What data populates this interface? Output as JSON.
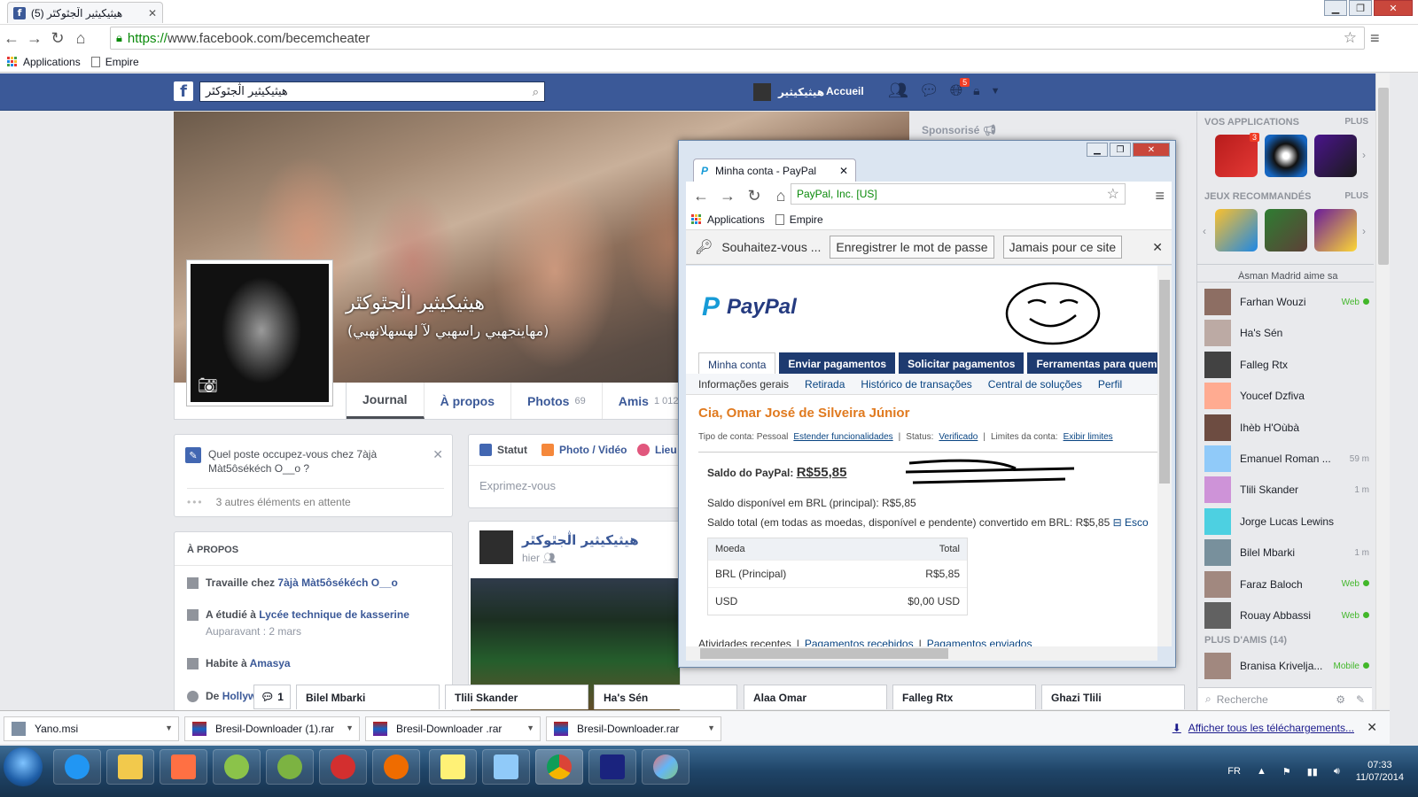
{
  "browser": {
    "tab_title": "(5) هيثيكيثير اڷجٿوكٿر",
    "url_scheme": "https://",
    "url_rest": "www.facebook.com/becemcheater",
    "bookmarks": [
      "Applications",
      "Empire"
    ]
  },
  "facebook": {
    "search_value": "هيثيكيثير اڷجٿوكٿر",
    "user_name": "هيثيكيثير",
    "home_label": "Accueil",
    "notif_count": "5",
    "profile_name": "هيثيكيثير اڷجٿوكٿر",
    "profile_subtitle": "(مهاينجهبي راسهبي لآ لهسهلانهبي)",
    "tabs": [
      {
        "label": "Journal",
        "count": ""
      },
      {
        "label": "À propos",
        "count": ""
      },
      {
        "label": "Photos",
        "count": "69"
      },
      {
        "label": "Amis",
        "count": "1 012"
      }
    ],
    "job_prompt": "Quel poste occupez-vous chez 7àjà Màt5ôsékéch O__o ?",
    "pending": "3 autres éléments en attente",
    "about_header": "À PROPOS",
    "about": {
      "work_prefix": "Travaille chez",
      "work_link": "7àjà Màt5ôsékéch O__o",
      "study_prefix": "A étudié à",
      "study_link": "Lycée technique de kasserine",
      "study_sub": "Auparavant : 2 mars",
      "lives_prefix": "Habite à",
      "lives_link": "Amasya",
      "from_prefix": "De",
      "from_link": "Hollyw"
    },
    "composer": {
      "status": "Statut",
      "photo": "Photo / Vidéo",
      "place": "Lieu",
      "placeholder": "Exprimez-vous"
    },
    "post": {
      "name": "هيثيكيثير اڷجٿوكٿر",
      "time": "hier"
    },
    "sponsored": "Sponsorisé",
    "sidebar": {
      "apps_header": "VOS APPLICATIONS",
      "more": "PLUS",
      "games_header": "JEUX RECOMMANDÉS",
      "app_badge": "3",
      "ticker": "Ásman Madrid aime sa",
      "contacts": [
        {
          "name": "Farhan Wouzi",
          "status": "Web",
          "online": true
        },
        {
          "name": "Ha's Sén",
          "status": "",
          "online": false
        },
        {
          "name": "Falleg Rtx",
          "status": "",
          "online": false
        },
        {
          "name": "Youcef Dzfiva",
          "status": "",
          "online": false
        },
        {
          "name": "Ihèb H'Oùbà",
          "status": "",
          "online": false
        },
        {
          "name": "Emanuel Roman ...",
          "status": "59 m",
          "online": false
        },
        {
          "name": "Tlili Skander",
          "status": "1 m",
          "online": false
        },
        {
          "name": "Jorge Lucas Lewins",
          "status": "",
          "online": false
        },
        {
          "name": "Bilel Mbarki",
          "status": "1 m",
          "online": false
        },
        {
          "name": "Faraz Baloch",
          "status": "Web",
          "online": true
        },
        {
          "name": "Rouay Abbassi",
          "status": "Web",
          "online": true
        }
      ],
      "friends_header": "PLUS D'AMIS (14)",
      "friend": {
        "name": "Branisa Krivelja...",
        "status": "Mobile"
      },
      "search_placeholder": "Recherche"
    },
    "chat_count": "1",
    "chat_tabs": [
      "Bilel Mbarki",
      "Tlili Skander",
      "Ha's Sén",
      "Alaa Omar",
      "Falleg Rtx",
      "Ghazi Tlili"
    ]
  },
  "paypal_window": {
    "tab_title": "Minha conta - PayPal",
    "omnibox": "PayPal, Inc. [US]",
    "bookmarks": [
      "Applications",
      "Empire"
    ],
    "save_prompt": "Souhaitez-vous ...",
    "save_btn": "Enregistrer le mot de passe",
    "never_btn": "Jamais pour ce site",
    "logo": "PayPal",
    "tabs": [
      "Minha conta",
      "Enviar pagamentos",
      "Solicitar pagamentos",
      "Ferramentas para quem"
    ],
    "subnav": [
      "Informações gerais",
      "Retirada",
      "Histórico de transações",
      "Central de soluções",
      "Perfil"
    ],
    "account_name": "Cia, Omar José de Silveira Júnior",
    "account_type_label": "Tipo de conta: Pessoal",
    "extend_link": "Estender funcionalidades",
    "status_label": "Status:",
    "status_value": "Verificado",
    "limits_label": "Limites da conta:",
    "limits_link": "Exibir limites",
    "balance_label": "Saldo do PayPal:",
    "balance_value": "R$55,85",
    "available": "Saldo disponível em BRL (principal): R$5,85",
    "total_line": "Saldo total (em todas as moedas, disponível e pendente) convertido em BRL: R$5,85",
    "total_link": "Esco",
    "table_headers": [
      "Moeda",
      "Total"
    ],
    "table_rows": [
      {
        "currency": "BRL  (Principal)",
        "total": "R$5,85"
      },
      {
        "currency": "USD",
        "total": "$0,00 USD"
      }
    ],
    "footer": [
      "Atividades recentes",
      "Pagamentos recebidos",
      "Pagamentos enviados"
    ]
  },
  "downloads": {
    "items": [
      "Yano.msi",
      "Bresil-Downloader (1).rar",
      "Bresil-Downloader .rar",
      "Bresil-Downloader.rar"
    ],
    "show_all": "Afficher tous les téléchargements..."
  },
  "taskbar": {
    "lang": "FR",
    "time": "07:33",
    "date": "11/07/2014"
  },
  "colors": {
    "facebook_blue": "#3b5998",
    "paypal_navy": "#1e3b70",
    "paypal_orange": "#e07a1f"
  }
}
